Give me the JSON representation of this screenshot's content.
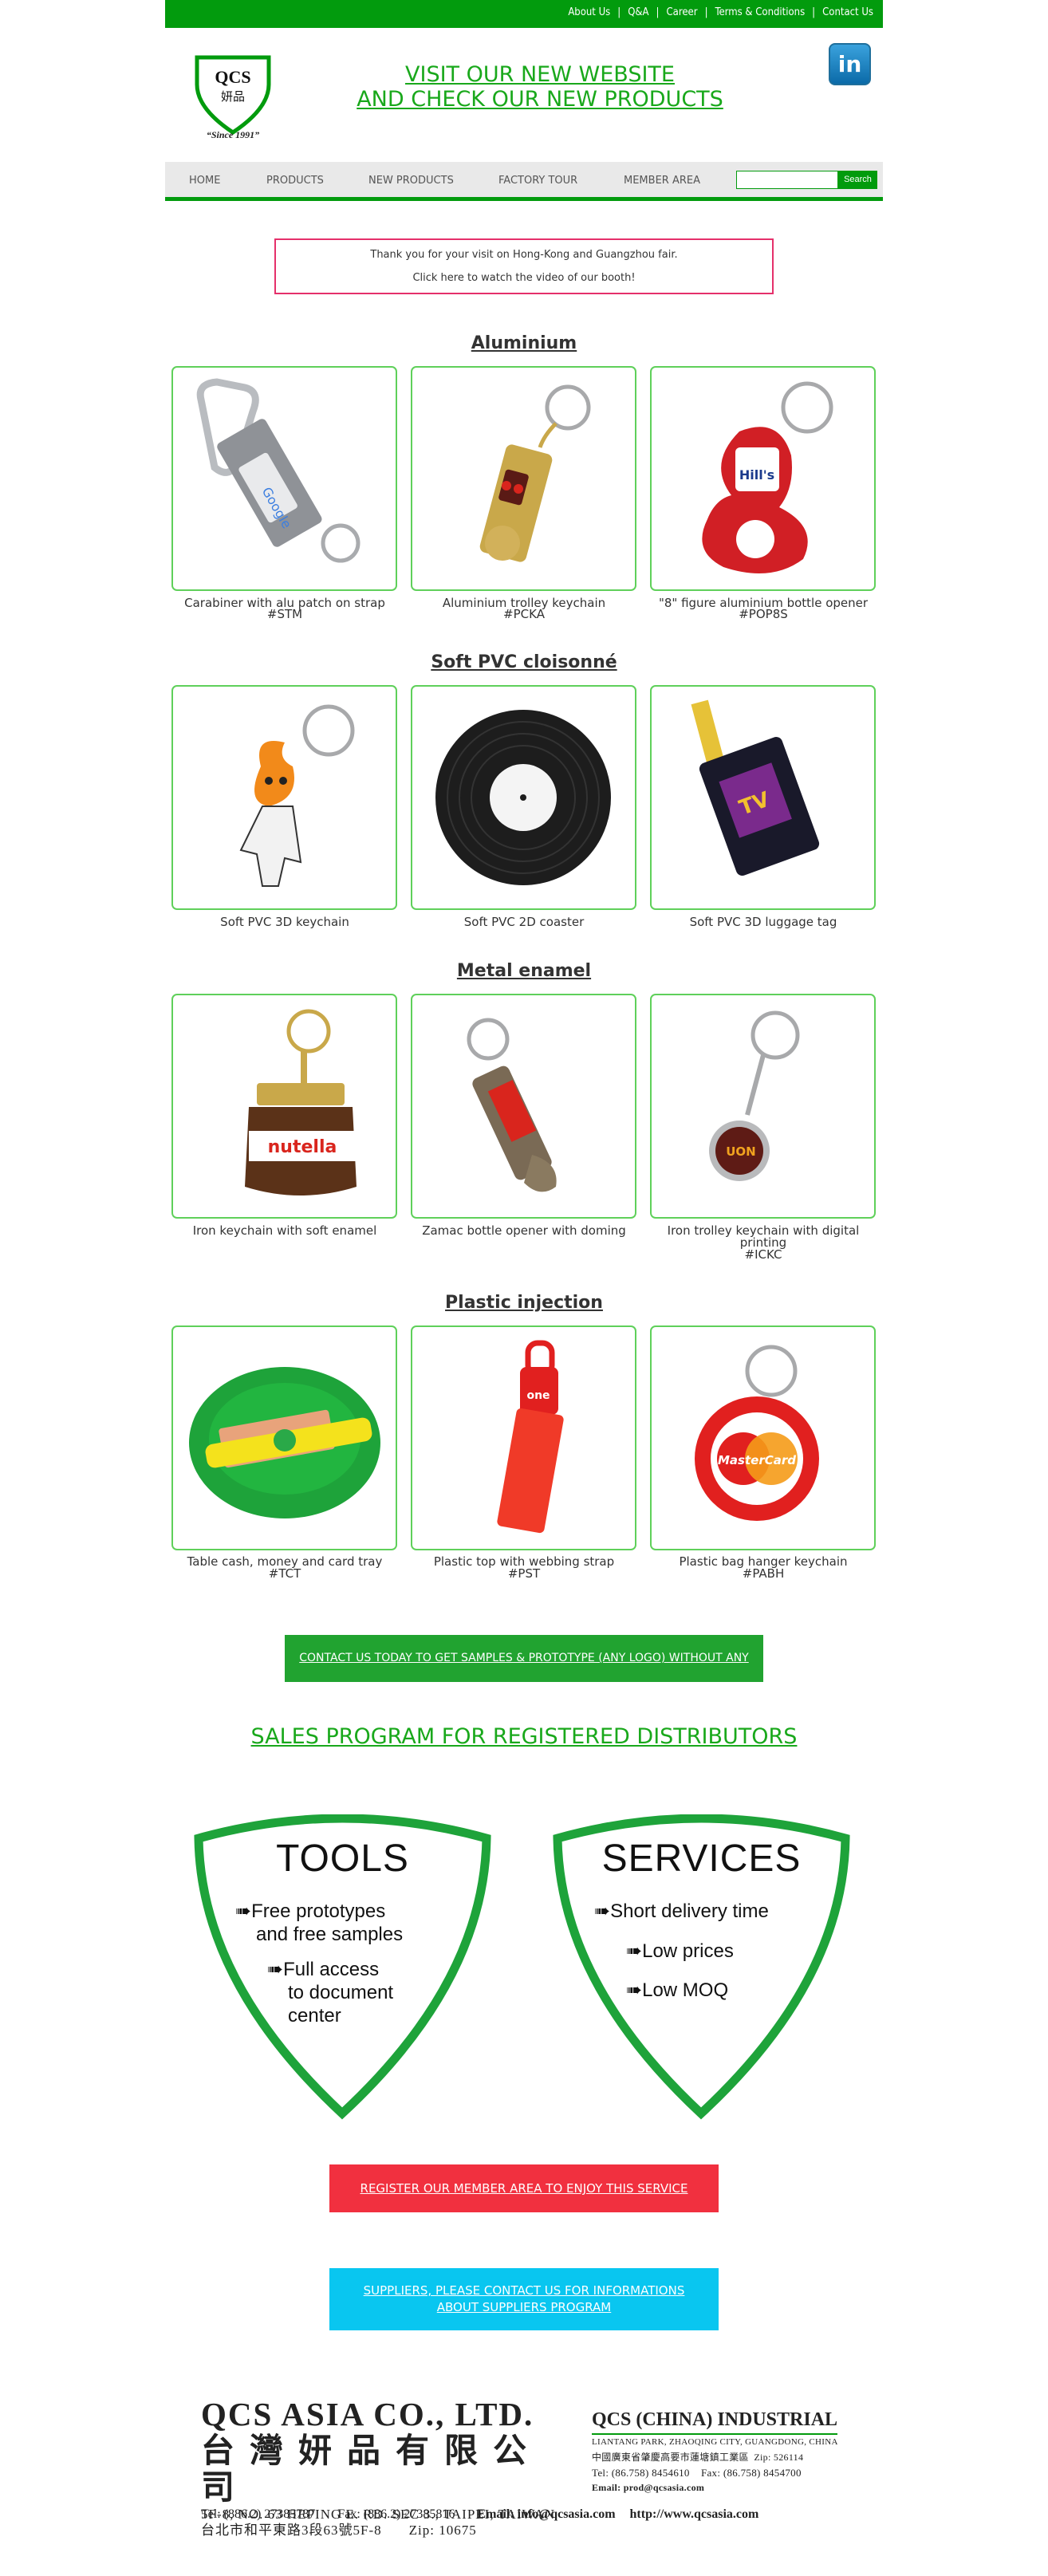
{
  "top_links": [
    "About Us",
    "Q&A",
    "Career",
    "Terms & Conditions",
    "Contact Us"
  ],
  "logo": {
    "name": "QCS",
    "chinese": "妍品",
    "tagline": "“Since 1991”"
  },
  "banner": {
    "line1": "VISIT OUR NEW WEBSITE",
    "line2": "AND CHECK OUR NEW PRODUCTS"
  },
  "social": {
    "linkedin": "in"
  },
  "nav": [
    "HOME",
    "PRODUCTS",
    "NEW PRODUCTS",
    "FACTORY TOUR",
    "MEMBER AREA"
  ],
  "search": {
    "button": "Search",
    "placeholder": ""
  },
  "notice": {
    "line1": "Thank you for your visit on Hong-Kong and Guangzhou fair.",
    "line2": "Click here to watch the video of our booth!"
  },
  "sections": [
    {
      "title": "Aluminium",
      "products": [
        {
          "caption": "Carabiner with alu patch on strap",
          "code": "#STM",
          "icon": "carabiner-keychain"
        },
        {
          "caption": "Aluminium trolley keychain",
          "code": "#PCKA",
          "icon": "trolley-keychain"
        },
        {
          "caption": "\"8\" figure aluminium bottle opener",
          "code": "#POP8S",
          "icon": "bottle-opener"
        }
      ]
    },
    {
      "title": "Soft PVC cloisonné",
      "products": [
        {
          "caption": "Soft PVC 3D keychain",
          "code": "",
          "icon": "pvc-mascot-keychain"
        },
        {
          "caption": "Soft PVC 2D coaster",
          "code": "",
          "icon": "vinyl-coaster"
        },
        {
          "caption": "Soft PVC 3D luggage tag",
          "code": "",
          "icon": "luggage-tag"
        }
      ]
    },
    {
      "title": "Metal enamel",
      "products": [
        {
          "caption": "Iron keychain with soft enamel",
          "code": "",
          "icon": "nutella-keychain"
        },
        {
          "caption": "Zamac bottle opener with doming",
          "code": "",
          "icon": "zamac-opener"
        },
        {
          "caption": "Iron trolley keychain with digital printing",
          "code": "#ICKC",
          "icon": "coin-keychain"
        }
      ]
    },
    {
      "title": "Plastic injection",
      "products": [
        {
          "caption": "Table cash, money and card tray",
          "code": "#TCT",
          "icon": "cash-tray"
        },
        {
          "caption": "Plastic top with webbing strap",
          "code": "#PST",
          "icon": "webbing-strap"
        },
        {
          "caption": "Plastic bag hanger keychain",
          "code": "#PABH",
          "icon": "bag-hanger"
        }
      ]
    }
  ],
  "cta_samples": "CONTACT US TODAY TO GET SAMPLES & PROTOTYPE (ANY LOGO) WITHOUT ANY CHARGE",
  "sales_title": "SALES PROGRAM FOR REGISTERED DISTRIBUTORS",
  "tools": {
    "title": "TOOLS",
    "items": [
      "Free prototypes",
      "and free samples",
      "Full access",
      "to document",
      "center"
    ]
  },
  "services": {
    "title": "SERVICES",
    "items": [
      "Short delivery time",
      "Low prices",
      "Low MOQ"
    ]
  },
  "cta_register": "REGISTER OUR MEMBER AREA TO ENJOY THIS SERVICE",
  "cta_suppliers": {
    "line1": "SUPPLIERS, PLEASE CONTACT US FOR INFORMATIONS",
    "line2": "ABOUT SUPPLIERS PROGRAM"
  },
  "footer": {
    "company": "QCS ASIA CO., LTD.",
    "company_cn": "台灣妍品有限公司",
    "address_en": "5F-8, NO. 63 HEPING E. RD. SEC 3., TAIPEI, TAIWAN",
    "address_cn": "台北市和平東路3段63號5F-8",
    "zip": "Zip: 10675",
    "tel": "Tel: (886.2) 27385787",
    "fax": "Fax: (886.2) 27385816",
    "email": "Email: info@qcsasia.com",
    "web": "http://www.qcsasia.com",
    "china_company": "QCS (CHINA) INDUSTRIAL",
    "china_address": "LIANTANG PARK, ZHAOQING CITY, GUANGDONG, CHINA",
    "china_address_cn": "中國廣東省肇慶高要市蓮塘鎮工業區",
    "china_zip": "Zip: 526114",
    "china_tel": "Tel: (86.758) 8454610",
    "china_fax": "Fax: (86.758) 8454700",
    "china_email": "Email: prod@qcsasia.com"
  },
  "colors": {
    "brand_green": "#029b0d",
    "card_border": "#5fd05a",
    "red": "#f1303f",
    "blue": "#09c6f0",
    "notice_border": "#e5306b"
  }
}
